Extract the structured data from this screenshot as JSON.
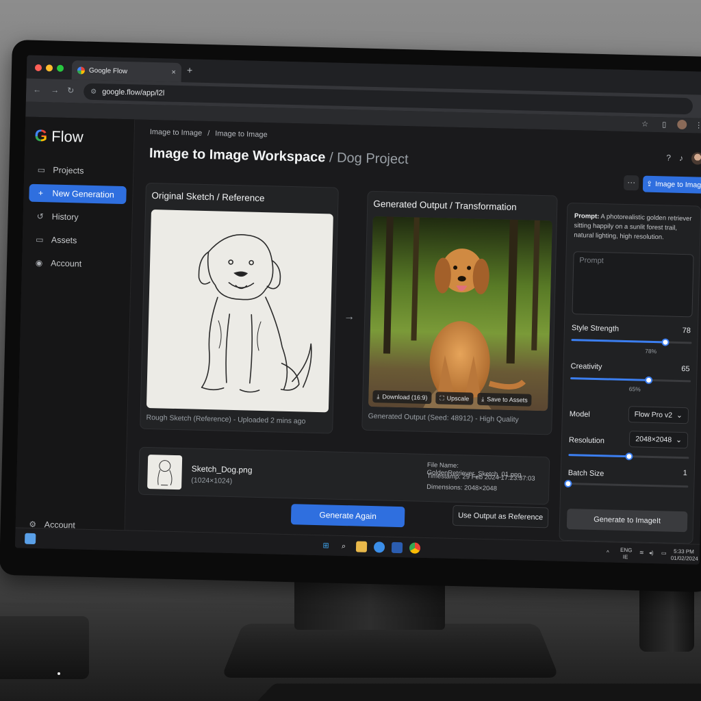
{
  "browser": {
    "tab_title": "Google Flow",
    "tab_close": "×",
    "new_tab": "+",
    "back": "←",
    "forward": "→",
    "reload": "↻",
    "url": "google.flow/app/l2l"
  },
  "app": {
    "logo_text": "Flow",
    "sidebar": {
      "items": [
        {
          "label": "Projects",
          "icon": "folder-icon"
        },
        {
          "label": "New Generation",
          "icon": "plus-icon"
        },
        {
          "label": "History",
          "icon": "history-icon"
        },
        {
          "label": "Assets",
          "icon": "folder-icon"
        },
        {
          "label": "Account",
          "icon": "account-icon"
        }
      ],
      "bottom_item": "Account"
    },
    "breadcrumb": [
      "Image to Image",
      "/",
      "Image to Image"
    ],
    "title": "Image to Image Workspace",
    "title_sep": "/",
    "subtitle": "Dog Project",
    "header": {
      "more_label": "···",
      "primary_button": "Image to Image"
    },
    "original_panel": {
      "title": "Original Sketch / Reference",
      "caption": "Rough Sketch (Reference) - Uploaded 2 mins ago"
    },
    "arrow": "→",
    "output_panel": {
      "title": "Generated Output / Transformation",
      "caption": "Generated Output (Seed: 48912) - High Quality",
      "actions": {
        "download": "Download (16:9)",
        "upscale": "Upscale",
        "save": "Save to Assets"
      }
    },
    "file_info": {
      "name": "Sketch_Dog.png",
      "dimensions": "(1024×1024)",
      "meta_file_name": "File Name: GoldenRetriever_Sketch_01.png",
      "meta_timestamp": "Timestamp: 29 Feb 2024 17:23:37:03",
      "meta_dimensions": "Dimensions: 2048×2048"
    },
    "buttons": {
      "generate_again": "Generate Again",
      "use_output": "Use Output as Reference"
    },
    "settings": {
      "prompt_label": "Prompt:",
      "prompt_text": "A photorealistic golden retriever sitting happily on a sunlit forest trail, natural lighting, high resolution.",
      "prompt_placeholder": "Prompt",
      "style_strength": {
        "label": "Style Strength",
        "value": "78",
        "pct": "78%",
        "fraction": 0.78
      },
      "creativity": {
        "label": "Creativity",
        "value": "65",
        "pct": "65%",
        "fraction": 0.65
      },
      "model": {
        "label": "Model",
        "value": "Flow Pro v2"
      },
      "resolution": {
        "label": "Resolution",
        "value": "2048×2048",
        "fraction": 0.5
      },
      "batch_size": {
        "label": "Batch Size",
        "value": "1",
        "fraction": 0.0
      },
      "generate_button": "Generate to ImageIt"
    },
    "tray": {
      "lang": "ENG",
      "lang_sub": "IE",
      "time": "5:33 PM",
      "date": "01/02/2024"
    },
    "colors": {
      "accent": "#2f6fdf",
      "background": "#1a1a1c"
    }
  }
}
